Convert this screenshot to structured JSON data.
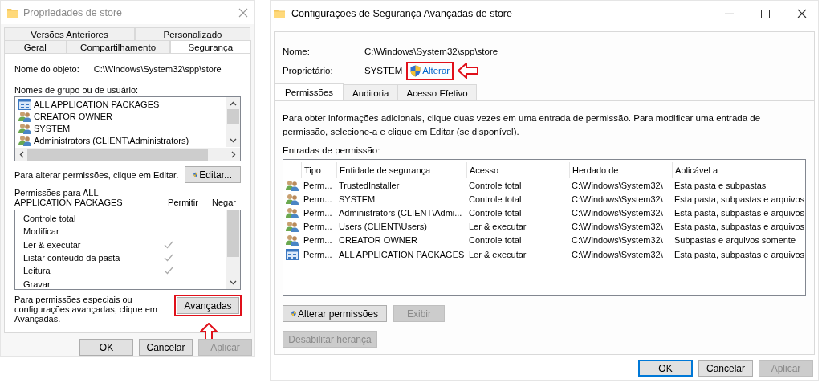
{
  "properties_dialog": {
    "title": "Propriedades de store",
    "tab_rows": [
      [
        {
          "label": "Versões Anteriores",
          "selected": false
        },
        {
          "label": "Personalizado",
          "selected": false
        }
      ],
      [
        {
          "label": "Geral",
          "selected": false
        },
        {
          "label": "Compartilhamento",
          "selected": false
        },
        {
          "label": "Segurança",
          "selected": true
        }
      ]
    ],
    "object_name_label": "Nome do objeto:",
    "object_name_value": "C:\\Windows\\System32\\spp\\store",
    "groups_label": "Nomes de grupo ou de usuário:",
    "groups": [
      {
        "name": "ALL APPLICATION PACKAGES",
        "kind": "package"
      },
      {
        "name": "CREATOR OWNER",
        "kind": "users"
      },
      {
        "name": "SYSTEM",
        "kind": "users"
      },
      {
        "name": "Administrators (CLIENT\\Administrators)",
        "kind": "users"
      }
    ],
    "edit_hint": "Para alterar permissões, clique em Editar.",
    "edit_button": "Editar...",
    "permissions_for_label": "Permissões para ALL APPLICATION PACKAGES",
    "allow_header": "Permitir",
    "deny_header": "Negar",
    "permissions": [
      {
        "name": "Controle total",
        "allow": false,
        "deny": false
      },
      {
        "name": "Modificar",
        "allow": false,
        "deny": false
      },
      {
        "name": "Ler & executar",
        "allow": true,
        "deny": false
      },
      {
        "name": "Listar conteúdo da pasta",
        "allow": true,
        "deny": false
      },
      {
        "name": "Leitura",
        "allow": true,
        "deny": false
      },
      {
        "name": "Gravar",
        "allow": false,
        "deny": false
      }
    ],
    "advanced_hint": "Para permissões especiais ou configurações avançadas, clique em Avançadas.",
    "advanced_button": {
      "label": "Avançadas",
      "highlighted": true
    },
    "buttons": [
      {
        "label": "OK",
        "disabled": false
      },
      {
        "label": "Cancelar",
        "disabled": false
      },
      {
        "label": "Aplicar",
        "disabled": true
      }
    ]
  },
  "advanced_dialog": {
    "title": "Configurações de Segurança Avançadas de store",
    "name_label": "Nome:",
    "name_value": "C:\\Windows\\System32\\spp\\store",
    "owner_label": "Proprietário:",
    "owner_value": "SYSTEM",
    "change_owner_link": {
      "label": "Alterar",
      "highlighted": true
    },
    "tabs": [
      {
        "label": "Permissões",
        "selected": true
      },
      {
        "label": "Auditoria",
        "selected": false
      },
      {
        "label": "Acesso Efetivo",
        "selected": false
      }
    ],
    "info_text": "Para obter informações adicionais, clique duas vezes em uma entrada de permissão. Para modificar uma entrada de permissão, selecione-a e clique em Editar (se disponível).",
    "entries_label": "Entradas de permissão:",
    "columns": [
      "Tipo",
      "Entidade de segurança",
      "Acesso",
      "Herdado de",
      "Aplicável a"
    ],
    "rows": [
      {
        "kind": "users",
        "cells": [
          "Perm...",
          "TrustedInstaller",
          "Controle total",
          "C:\\Windows\\System32\\",
          "Esta pasta e subpastas"
        ]
      },
      {
        "kind": "users",
        "cells": [
          "Perm...",
          "SYSTEM",
          "Controle total",
          "C:\\Windows\\System32\\",
          "Esta pasta, subpastas e arquivos"
        ]
      },
      {
        "kind": "users",
        "cells": [
          "Perm...",
          "Administrators (CLIENT\\Admi...",
          "Controle total",
          "C:\\Windows\\System32\\",
          "Esta pasta, subpastas e arquivos"
        ]
      },
      {
        "kind": "users",
        "cells": [
          "Perm...",
          "Users (CLIENT\\Users)",
          "Ler & executar",
          "C:\\Windows\\System32\\",
          "Esta pasta, subpastas e arquivos"
        ]
      },
      {
        "kind": "users",
        "cells": [
          "Perm...",
          "CREATOR OWNER",
          "Controle total",
          "C:\\Windows\\System32\\",
          "Subpastas e arquivos somente"
        ]
      },
      {
        "kind": "package",
        "cells": [
          "Perm...",
          "ALL APPLICATION PACKAGES",
          "Ler & executar",
          "C:\\Windows\\System32\\",
          "Esta pasta, subpastas e arquivos"
        ]
      }
    ],
    "action_buttons": [
      {
        "label": "Alterar permissões",
        "shield": true,
        "disabled": false
      },
      {
        "label": "Exibir",
        "shield": false,
        "disabled": true
      }
    ],
    "inheritance_button": {
      "label": "Desabilitar herança",
      "disabled": true
    },
    "buttons": [
      {
        "label": "OK",
        "disabled": false,
        "default": true
      },
      {
        "label": "Cancelar",
        "disabled": false,
        "default": false
      },
      {
        "label": "Aplicar",
        "disabled": true,
        "default": false
      }
    ]
  }
}
